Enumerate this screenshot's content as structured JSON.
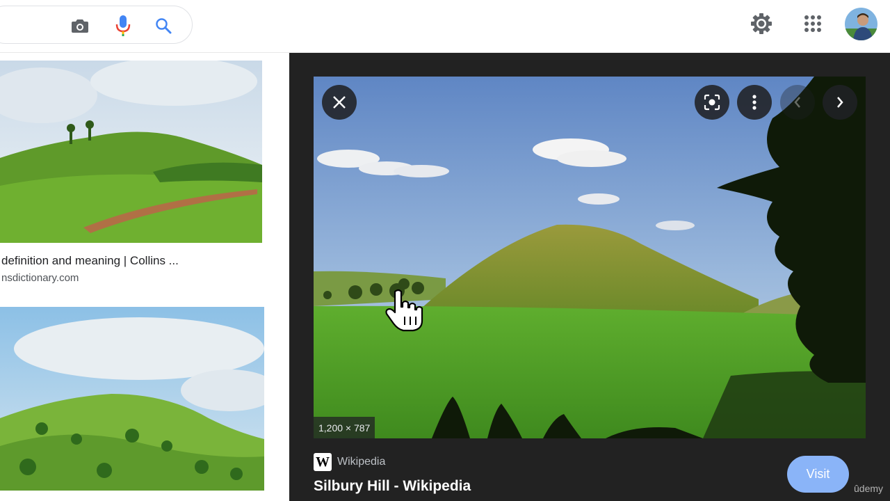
{
  "search": {
    "camera_icon": "camera-icon",
    "mic_icon": "microphone-icon",
    "search_icon": "search-icon"
  },
  "header": {
    "settings_icon": "gear-icon",
    "apps_icon": "apps-grid-icon",
    "avatar_icon": "avatar"
  },
  "results": [
    {
      "title": "definition and meaning | Collins ...",
      "source": "nsdictionary.com"
    }
  ],
  "viewer": {
    "dimensions": "1,200 × 787",
    "source_name": "Wikipedia",
    "source_logo": "W",
    "title": "Silbury Hill - Wikipedia",
    "visit_label": "Visit",
    "close_icon": "close-icon",
    "lens_icon": "lens-icon",
    "more_icon": "more-vert-icon",
    "prev_icon": "chevron-left-icon",
    "next_icon": "chevron-right-icon"
  },
  "watermark": "ûdemy",
  "colors": {
    "viewer_bg": "#222222",
    "visit_button": "#8ab4f8",
    "mic_red": "#ea4335",
    "mic_blue": "#4285f4",
    "search_blue": "#4285f4"
  }
}
